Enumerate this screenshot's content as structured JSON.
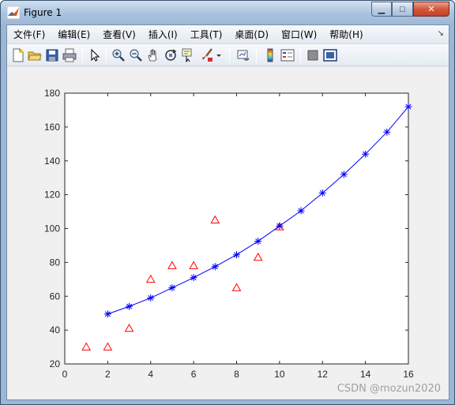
{
  "window": {
    "title": "Figure 1",
    "buttons": {
      "minimize": "▁",
      "maximize": "□",
      "close": "✕"
    }
  },
  "menubar": {
    "items": [
      "文件(F)",
      "编辑(E)",
      "查看(V)",
      "插入(I)",
      "工具(T)",
      "桌面(D)",
      "窗口(W)",
      "帮助(H)"
    ]
  },
  "toolbar": {
    "icons": [
      "new-figure-icon",
      "open-file-icon",
      "save-icon",
      "print-icon",
      "select-arrow-icon",
      "zoom-in-icon",
      "zoom-out-icon",
      "pan-hand-icon",
      "rotate-3d-icon",
      "data-cursor-icon",
      "brush-icon",
      "link-plot-icon",
      "colorbar-icon",
      "legend-icon",
      "hide-plot-tools-icon",
      "show-plot-tools-icon"
    ]
  },
  "watermark": "CSDN @mozun2020",
  "colors": {
    "fit_line": "#0000ff",
    "observed": "#ff0000",
    "axes_bg": "#ffffff",
    "figure_bg": "#f0f0f0"
  },
  "chart_data": {
    "type": "scatter",
    "title": "",
    "xlabel": "",
    "ylabel": "",
    "xlim": [
      0,
      16
    ],
    "ylim": [
      20,
      180
    ],
    "xticks": [
      0,
      2,
      4,
      6,
      8,
      10,
      12,
      14,
      16
    ],
    "yticks": [
      20,
      40,
      60,
      80,
      100,
      120,
      140,
      160,
      180
    ],
    "grid": false,
    "series": [
      {
        "marker": "triangle",
        "color": "#ff0000",
        "x": [
          1,
          2,
          3,
          4,
          5,
          6,
          7,
          8,
          9,
          10
        ],
        "y": [
          30,
          30,
          41,
          70,
          78,
          78,
          105,
          65,
          83,
          101
        ]
      },
      {
        "marker": "asterisk",
        "color": "#0000ff",
        "line": true,
        "x": [
          2,
          3,
          4,
          5,
          6,
          7,
          8,
          9,
          10,
          11,
          12,
          13,
          14,
          15,
          16
        ],
        "y": [
          49.5,
          54,
          59,
          65,
          71,
          77.5,
          84.5,
          92.5,
          101.5,
          110.5,
          121,
          132,
          144,
          157,
          172
        ]
      }
    ]
  }
}
